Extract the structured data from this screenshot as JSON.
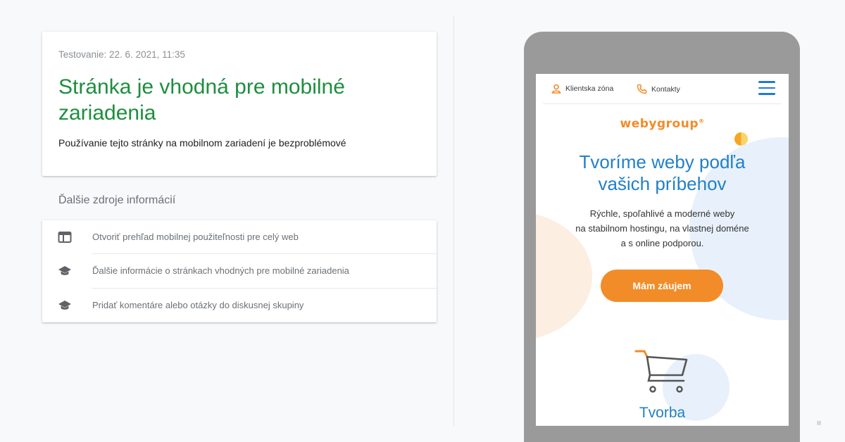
{
  "result": {
    "test_date": "Testovanie: 22. 6. 2021, 11:35",
    "title": "Stránka je vhodná pre mobilné zariadenia",
    "description": "Používanie tejto stránky na mobilnom zariadení je bezproblémové"
  },
  "resources": {
    "heading": "Ďalšie zdroje informácií",
    "items": [
      {
        "label": "Otvoriť prehľad mobilnej použiteľnosti pre celý web",
        "icon": "dashboard-icon"
      },
      {
        "label": "Ďalšie informácie o stránkach vhodných pre mobilné zariadenia",
        "icon": "school-icon"
      },
      {
        "label": "Pridať komentáre alebo otázky do diskusnej skupiny",
        "icon": "school-icon"
      }
    ]
  },
  "preview": {
    "client_zone": "Klientska zóna",
    "contacts": "Kontakty",
    "logo": "webygroup",
    "logo_mark": "®",
    "hero_title": "Tvoríme weby podľa vašich príbehov",
    "hero_desc_line1": "Rýchle, spoľahlivé a moderné weby",
    "hero_desc_line2": "na stabilnom hostingu, na vlastnej doméne",
    "hero_desc_line3": "a s online podporou.",
    "cta_label": "Mám záujem",
    "section_title": "Tvorba",
    "colors": {
      "accent_orange": "#f28c28",
      "accent_blue": "#2280c8",
      "success_green": "#1e8e3e"
    }
  }
}
